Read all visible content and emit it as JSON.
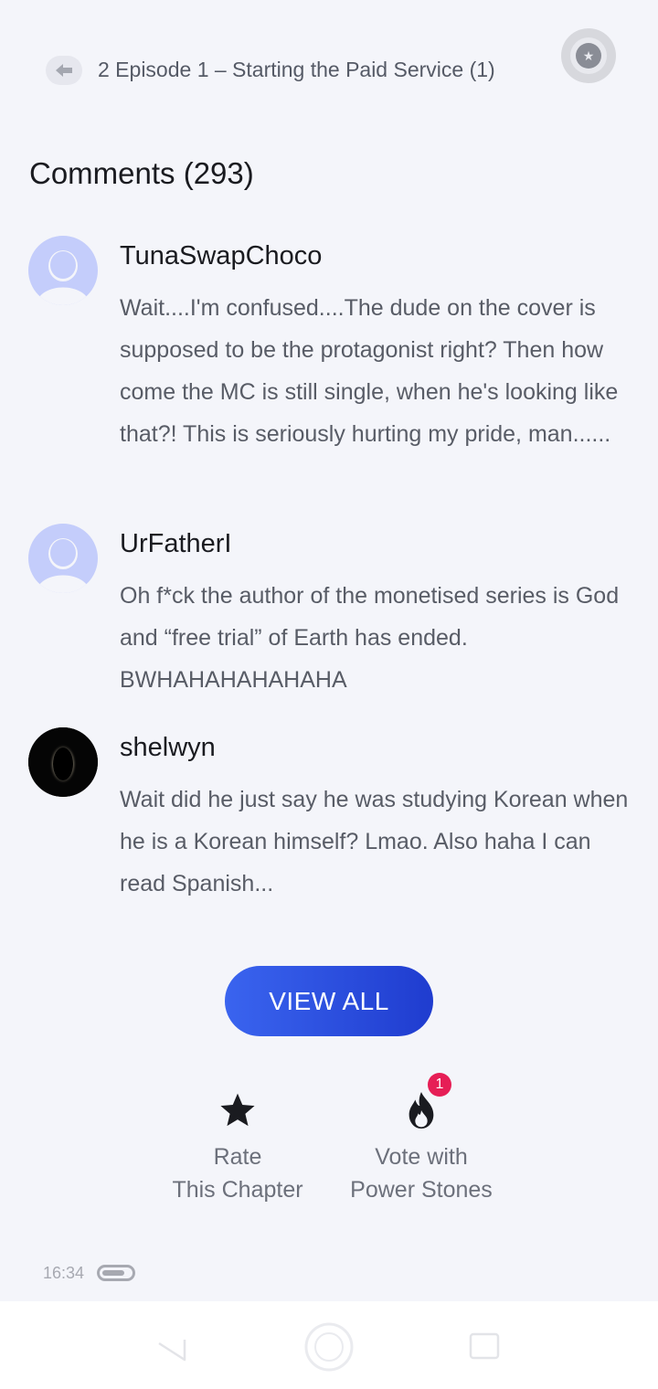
{
  "header": {
    "chapter_title": "2  Episode 1 – Starting the Paid Service (1)",
    "back_icon": "back-arrow-icon",
    "badge_icon": "medal-icon"
  },
  "comments_section": {
    "title": "Comments (293)",
    "comments": [
      {
        "username": "TunaSwapChoco",
        "avatar": "default-avatar",
        "text": "Wait....I'm confused....The dude on the cover is supposed to be the protagonist right? Then how come the MC is still single, when he's looking like that?! This is seriously hurting my pride, man......"
      },
      {
        "username": "UrFatherI",
        "avatar": "default-avatar",
        "text": "Oh f*ck the author of the monetised series is God and “free trial” of Earth has ended. BWHAHAHAHAHAHA"
      },
      {
        "username": "shelwyn",
        "avatar": "eclipse-avatar",
        "text": "Wait did he just say he was studying Korean when he is a Korean himself? Lmao. Also haha I can read Spanish..."
      }
    ],
    "view_all_label": "VIEW ALL"
  },
  "actions": {
    "rate": {
      "line1": "Rate",
      "line2": "This Chapter",
      "icon": "star-icon"
    },
    "vote": {
      "line1": "Vote with",
      "line2": "Power Stones",
      "icon": "flame-icon",
      "badge_count": "1"
    }
  },
  "status": {
    "time": "16:34",
    "battery_level": 0.8
  },
  "colors": {
    "accent": "#2f55e4",
    "avatar_default": "#c4cdfb",
    "notification": "#e61e56",
    "background": "#f4f5fa"
  }
}
